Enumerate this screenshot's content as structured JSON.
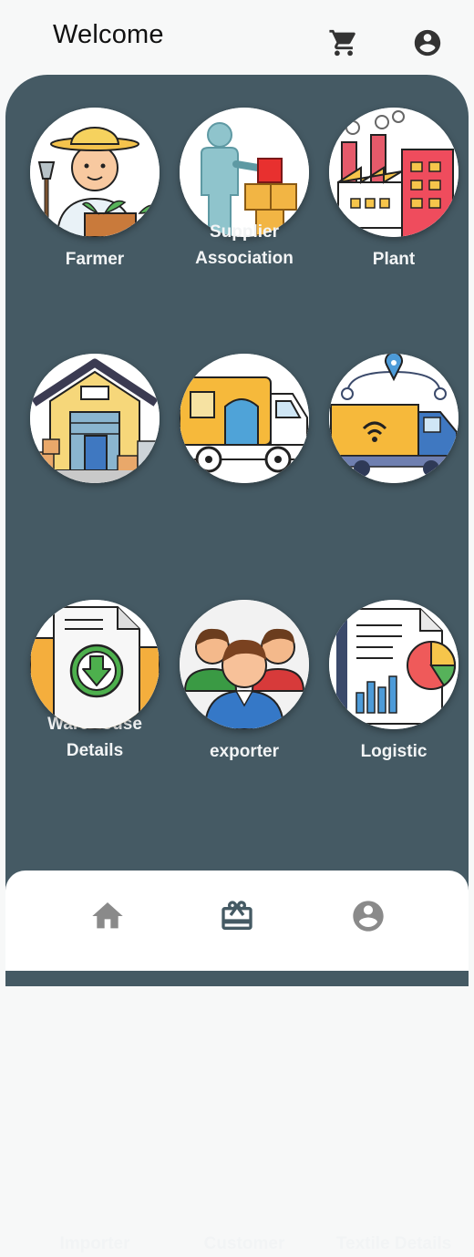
{
  "header": {
    "title": "Welcome"
  },
  "icons": {
    "cart": "cart-icon",
    "account": "account-circle-icon"
  },
  "tiles": [
    {
      "label": "Farmer",
      "icon": "farmer-icon"
    },
    {
      "label": "Supplier\nAssociation",
      "icon": "supplier-icon"
    },
    {
      "label": "Plant",
      "icon": "factory-icon"
    },
    {
      "label": "WareHouse\nDetails",
      "icon": "warehouse-icon"
    },
    {
      "label": "exporter",
      "icon": "truck-icon"
    },
    {
      "label": "Logistic",
      "icon": "logistics-icon"
    },
    {
      "label": "Importer",
      "icon": "download-document-icon"
    },
    {
      "label": "Customer",
      "icon": "people-icon"
    },
    {
      "label": "Textile Details",
      "icon": "report-chart-icon"
    }
  ],
  "bottom_nav": {
    "items": [
      "home-icon",
      "gift-card-icon",
      "profile-icon"
    ]
  },
  "colors": {
    "panel": "#455a64",
    "nav_active": "#455a64",
    "nav_inactive": "#8a8a8a"
  }
}
